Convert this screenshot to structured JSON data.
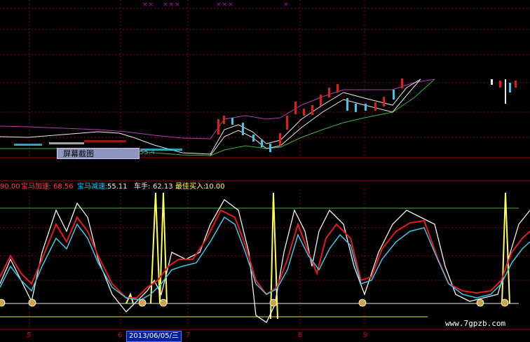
{
  "indicator": {
    "first_value": "90.00",
    "items": [
      {
        "name": "宝马加速:",
        "value": "68.56",
        "name_color": "#ff3b3b",
        "value_color": "#ff3b3b"
      },
      {
        "name": "宝马减速:",
        "value": "55.11",
        "name_color": "#00d0ff",
        "value_color": "#e8e8e8"
      },
      {
        "name": "车手:",
        "value": "62.13",
        "name_color": "#e8e8e8",
        "value_color": "#e8e8e8"
      },
      {
        "name": "最佳买入:",
        "value": "10.00",
        "name_color": "#ffff66",
        "value_color": "#ffff66"
      }
    ]
  },
  "tooltip": {
    "label": "屏幕截图",
    "tail": "55.4"
  },
  "x_axis": {
    "date_box": "2013/06/05/三",
    "ticks": [
      "5",
      "6",
      "7",
      "8",
      "9"
    ]
  },
  "top_marks": [
    "××",
    "×××",
    "×××",
    "×"
  ],
  "watermark": "www.7gpzb.com",
  "colors": {
    "accel": "#e21b1b",
    "decel": "#3fc6e8",
    "driver": "#f2f2f2",
    "buy": "#ffff55",
    "ref_green": "#3fae3f",
    "purple": "#c040c0"
  }
}
